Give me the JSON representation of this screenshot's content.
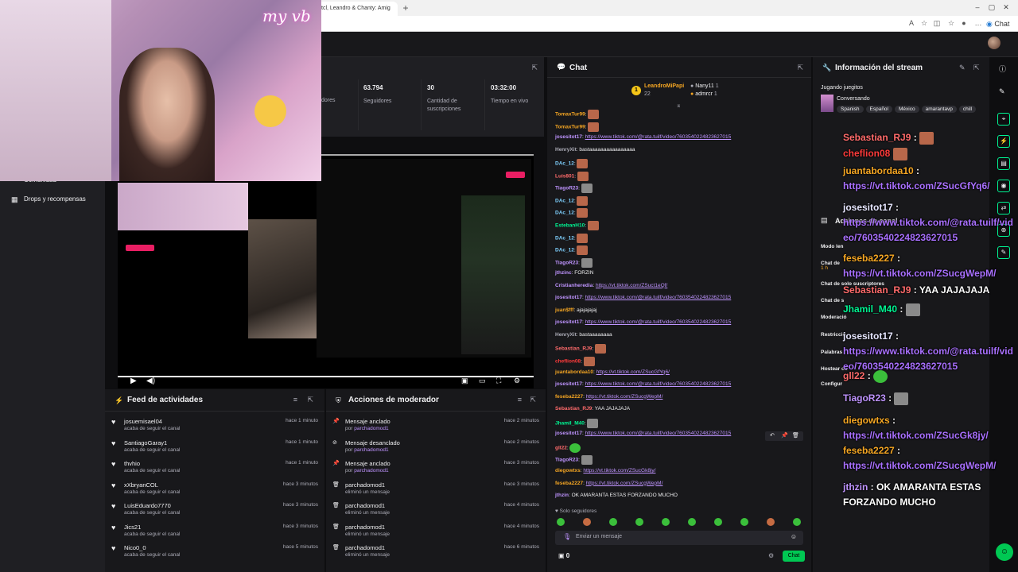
{
  "browser": {
    "tab_title": "tcl, Leandro & Chanty: Amig",
    "new_tab": "+",
    "chat_label": "Chat"
  },
  "sidebar": {
    "items": [
      {
        "label": "Comunidad"
      },
      {
        "label": "Drops y recompensas"
      }
    ]
  },
  "stats": [
    {
      "value": "",
      "label": "dores"
    },
    {
      "value": "63.794",
      "label": "Seguidores"
    },
    {
      "value": "30",
      "label": "Cantidad de suscripciones"
    },
    {
      "value": "03:32:00",
      "label": "Tiempo en vivo"
    }
  ],
  "webcam_signature": "my vb",
  "video": {
    "progress_pct": 100
  },
  "feed": {
    "title": "Feed de actividades",
    "items": [
      {
        "name": "josuemisael04",
        "sub": "acaba de seguir el canal",
        "time": "hace 1 minuto"
      },
      {
        "name": "SantiagoGaray1",
        "sub": "acaba de seguir el canal",
        "time": "hace 1 minuto"
      },
      {
        "name": "thvhio",
        "sub": "acaba de seguir el canal",
        "time": "hace 1 minuto"
      },
      {
        "name": "xXbryanCOL",
        "sub": "acaba de seguir el canal",
        "time": "hace 3 minutos"
      },
      {
        "name": "LuisEduardo7770",
        "sub": "acaba de seguir el canal",
        "time": "hace 3 minutos"
      },
      {
        "name": "Jics21",
        "sub": "acaba de seguir el canal",
        "time": "hace 3 minutos"
      },
      {
        "name": "Nico0_0",
        "sub": "acaba de seguir el canal",
        "time": "hace 5 minutos"
      }
    ]
  },
  "mod": {
    "title": "Acciones de moderador",
    "items": [
      {
        "name": "Mensaje anclado",
        "sub": "por",
        "by": "parchadomod1",
        "time": "hace 2 minutos",
        "icon": "pin-icon"
      },
      {
        "name": "Mensaje desanclado",
        "sub": "por",
        "by": "parchadomod1",
        "time": "hace 2 minutos",
        "icon": "unpin-icon"
      },
      {
        "name": "Mensaje anclado",
        "sub": "por",
        "by": "parchadomod1",
        "time": "hace 3 minutos",
        "icon": "pin-icon"
      },
      {
        "name": "parchadomod1",
        "sub": "eliminó un mensaje",
        "by": "",
        "time": "hace 3 minutos",
        "icon": "trash-icon"
      },
      {
        "name": "parchadomod1",
        "sub": "eliminó un mensaje",
        "by": "",
        "time": "hace 4 minutos",
        "icon": "trash-icon"
      },
      {
        "name": "parchadomod1",
        "sub": "eliminó un mensaje",
        "by": "",
        "time": "hace 4 minutos",
        "icon": "trash-icon"
      },
      {
        "name": "parchadomod1",
        "sub": "eliminó un mensaje",
        "by": "",
        "time": "hace 6 minutos",
        "icon": "trash-icon"
      }
    ]
  },
  "chat": {
    "title": "Chat",
    "top_gifters": [
      {
        "name": "LeandroMiPapi",
        "count": "22"
      },
      {
        "name": "Nany11",
        "count": "1"
      },
      {
        "name": "admrcr",
        "count": "1"
      }
    ],
    "rank_badge": "1",
    "messages": [
      {
        "user": "TomaxTur99",
        "color": "#f5a623",
        "text": "",
        "link": "",
        "emote": "red"
      },
      {
        "user": "TomaxTur99",
        "color": "#f5a623",
        "text": "",
        "link": "",
        "emote": "red"
      },
      {
        "user": "josesitot17",
        "color": "#bf94ff",
        "text": "",
        "link": "https://www.tiktok.com/@rata.tuilf/video/7603540224823627015",
        "emote": ""
      },
      {
        "user": "HenryXit",
        "color": "#adadb8",
        "text": "bastaaaaaaaaaaaaaaaa",
        "link": "",
        "emote": ""
      },
      {
        "user": "DAc_12",
        "color": "#7fd1ff",
        "text": "",
        "link": "",
        "emote": "red"
      },
      {
        "user": "Luis801",
        "color": "#ff6b6b",
        "text": "",
        "link": "",
        "emote": "red"
      },
      {
        "user": "TiagoR23",
        "color": "#bf94ff",
        "text": "",
        "link": "",
        "emote": "cat"
      },
      {
        "user": "DAc_12",
        "color": "#7fd1ff",
        "text": "",
        "link": "",
        "emote": "red"
      },
      {
        "user": "DAc_12",
        "color": "#7fd1ff",
        "text": "",
        "link": "",
        "emote": "red"
      },
      {
        "user": "EstebanH10",
        "color": "#00f593",
        "text": "",
        "link": "",
        "emote": "red"
      },
      {
        "user": "DAc_12",
        "color": "#7fd1ff",
        "text": "",
        "link": "",
        "emote": "red"
      },
      {
        "user": "DAc_12",
        "color": "#7fd1ff",
        "text": "",
        "link": "",
        "emote": "red"
      },
      {
        "user": "TiagoR23",
        "color": "#bf94ff",
        "text": "",
        "link": "",
        "emote": "cat"
      },
      {
        "user": "jthzinc",
        "color": "#bf94ff",
        "text": "FORZIN",
        "link": "",
        "emote": ""
      },
      {
        "user": "Cristianheredia",
        "color": "#bf94ff",
        "text": "",
        "link": "https://vt.tiktok.com/ZSuct1eQf/",
        "emote": ""
      },
      {
        "user": "josesitot17",
        "color": "#bf94ff",
        "text": "",
        "link": "https://www.tiktok.com/@rata.tuilf/video/7603540224823627015",
        "emote": ""
      },
      {
        "user": "juan$fff",
        "color": "#f5a623",
        "text": "ajajajajaj",
        "link": "",
        "emote": ""
      },
      {
        "user": "josesitot17",
        "color": "#bf94ff",
        "text": "",
        "link": "https://www.tiktok.com/@rata.tuilf/video/7603540224823627015",
        "emote": ""
      },
      {
        "user": "HenryXit",
        "color": "#adadb8",
        "text": "bastaaaaaaaa",
        "link": "",
        "emote": ""
      },
      {
        "user": "Sebastian_RJ9",
        "color": "#ff6b6b",
        "text": "",
        "link": "",
        "emote": "red"
      },
      {
        "user": "cheflion08",
        "color": "#ff3b3b",
        "text": "",
        "link": "",
        "emote": "red"
      },
      {
        "user": "juantabordaa10",
        "color": "#f5a623",
        "text": "",
        "link": "https://vt.tiktok.com/ZSucGfYq6/",
        "emote": ""
      },
      {
        "user": "josesitot17",
        "color": "#bf94ff",
        "text": "",
        "link": "https://www.tiktok.com/@rata.tuilf/video/7603540224823627015",
        "emote": ""
      },
      {
        "user": "feseba2227",
        "color": "#f5a623",
        "text": "",
        "link": "https://vt.tiktok.com/ZSucgWepM/",
        "emote": ""
      },
      {
        "user": "Sebastian_RJ9",
        "color": "#ff6b6b",
        "text": "YAA JAJAJAJA",
        "link": "",
        "emote": ""
      },
      {
        "user": "Jhamil_M40",
        "color": "#00f593",
        "text": "",
        "link": "",
        "emote": "cat"
      },
      {
        "user": "josesitot17",
        "color": "#bf94ff",
        "text": "",
        "link": "https://www.tiktok.com/@rata.tuilf/video/7603540224823627015",
        "emote": ""
      },
      {
        "user": "gll22",
        "color": "#ff6b6b",
        "text": "",
        "link": "",
        "emote": "green"
      },
      {
        "user": "TiagoR23",
        "color": "#bf94ff",
        "text": "",
        "link": "",
        "emote": "cat"
      },
      {
        "user": "diegowtxs",
        "color": "#f5a623",
        "text": "",
        "link": "https://vt.tiktok.com/ZSucGk8jy/",
        "emote": ""
      },
      {
        "user": "feseba2227",
        "color": "#f5a623",
        "text": "",
        "link": "https://vt.tiktok.com/ZSucgWepM/",
        "emote": ""
      },
      {
        "user": "jthzin",
        "color": "#bf94ff",
        "text": "OK AMARANTA ESTAS FORZANDO MUCHO",
        "link": "",
        "emote": ""
      }
    ],
    "followers_only": "Solo seguidores",
    "input_placeholder": "Enviar un mensaje",
    "points": "0",
    "send_label": "Chat"
  },
  "info": {
    "title": "Información del stream",
    "game_line": "Jugando juegitos",
    "category": "Conversando",
    "tags": [
      "Spanish",
      "Español",
      "México",
      "amarantavp",
      "chill"
    ],
    "channel_actions_title": "Acciones de canal",
    "mod_rows": [
      "Modo len",
      "Chat de",
      "Chat de solo suscriptores",
      "Chat de s",
      "Moderació",
      "Restricció",
      "Palabras",
      "Hostear ca",
      "Configur"
    ],
    "mod_sub": "1 h"
  },
  "overlay": {
    "messages": [
      {
        "user": "Sebastian_RJ9",
        "color": "#ff6b6b",
        "text": "",
        "link": "",
        "emote": "red"
      },
      {
        "user": "cheflion08",
        "color": "#ff3b3b",
        "text": "",
        "link": "",
        "emote": "red",
        "no_colon": true
      },
      {
        "user": "juantabordaa10",
        "color": "#f5a623",
        "text": "",
        "link": "https://vt.tiktok.com/ZSucGfYq6/",
        "emote": ""
      },
      {
        "user": "josesitot17",
        "color": "#e6e6ff",
        "text": "",
        "link": "https://www.tiktok.com/@rata.tuilf/video/7603540224823627015",
        "emote": ""
      },
      {
        "user": "feseba2227",
        "color": "#f5a623",
        "text": "",
        "link": "https://vt.tiktok.com/ZSucgWepM/",
        "emote": ""
      },
      {
        "user": "Sebastian_RJ9",
        "color": "#ff6b6b",
        "text": "YAA JAJAJAJA",
        "link": "",
        "emote": ""
      },
      {
        "user": "Jhamil_M40",
        "color": "#00f593",
        "text": "",
        "link": "",
        "emote": "cat"
      },
      {
        "user": "josesitot17",
        "color": "#e6e6ff",
        "text": "",
        "link": "https://www.tiktok.com/@rata.tuilf/video/7603540224823627015",
        "emote": ""
      },
      {
        "user": "gll22",
        "color": "#ff6b6b",
        "text": "",
        "link": "",
        "emote": "green"
      },
      {
        "user": "TiagoR23",
        "color": "#bf94ff",
        "text": "",
        "link": "",
        "emote": "cat"
      },
      {
        "user": "diegowtxs",
        "color": "#f5a623",
        "text": "",
        "link": "https://vt.tiktok.com/ZSucGk8jy/",
        "emote": ""
      },
      {
        "user": "feseba2227",
        "color": "#f5a623",
        "text": "",
        "link": "https://vt.tiktok.com/ZSucgWepM/",
        "emote": ""
      },
      {
        "user": "jthzin",
        "color": "#bf94ff",
        "text": "OK AMARANTA ESTAS FORZANDO MUCHO",
        "link": "",
        "emote": ""
      }
    ]
  }
}
